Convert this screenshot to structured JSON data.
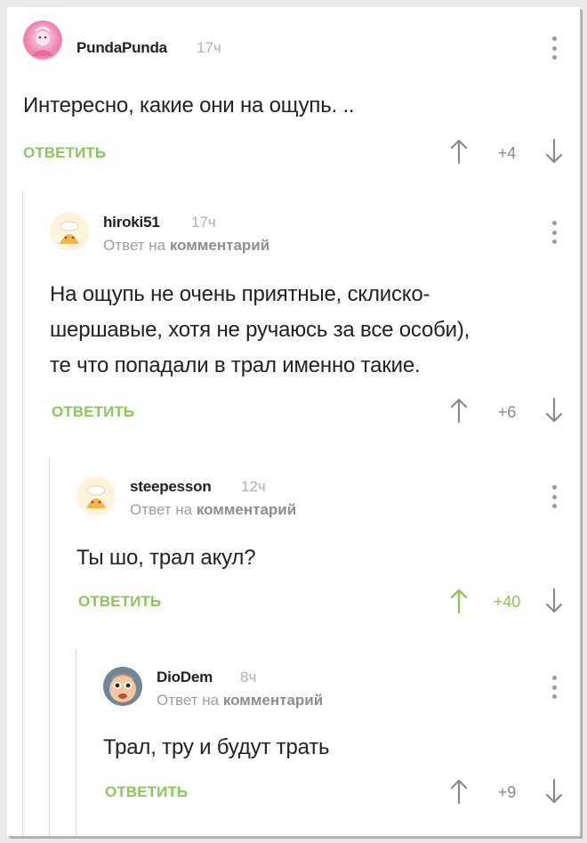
{
  "reply_label": "ОТВЕТИТЬ",
  "reply_to_prefix": "Ответ на",
  "reply_to_target": "комментарий",
  "comments": [
    {
      "author": "PundaPunda",
      "time": "17ч",
      "text": "Интересно, какие они на ощупь. ..",
      "rating": "+4",
      "upvoted": false,
      "avatar_icon": "pink-avatar-icon"
    },
    {
      "author": "hiroki51",
      "time": "17ч",
      "text_lines": [
        "На ощупь не очень приятные, склиско-",
        "шершавые, хотя не ручаюсь за все особи),",
        "те что попадали в трал именно такие."
      ],
      "rating": "+6",
      "upvoted": false,
      "avatar_icon": "default-chef-avatar-icon"
    },
    {
      "author": "steepesson",
      "time": "12ч",
      "text": "Ты шо, трал акул?",
      "rating": "+40",
      "upvoted": true,
      "avatar_icon": "default-chef-avatar-icon"
    },
    {
      "author": "DioDem",
      "time": "8ч",
      "text": "Трал, тру и будут трать",
      "rating": "+9",
      "upvoted": false,
      "avatar_icon": "baby-face-avatar-icon"
    }
  ],
  "colors": {
    "accent_green": "#8ac858",
    "text": "#222222",
    "muted": "#9f9f9f",
    "thread_line": "#d9d9d9"
  }
}
